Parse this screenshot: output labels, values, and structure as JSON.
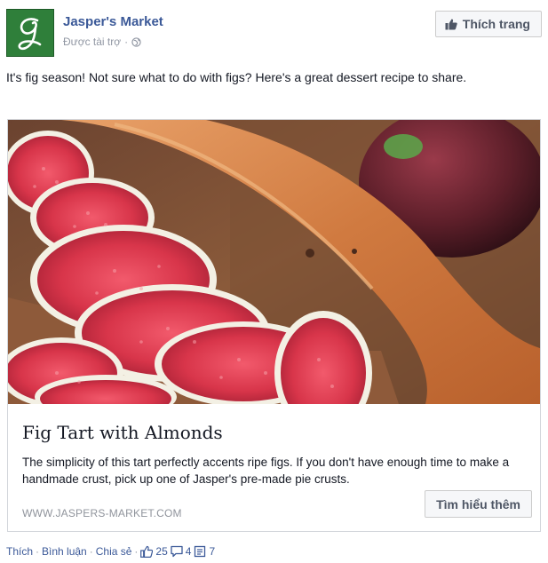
{
  "header": {
    "page_name": "Jasper's Market",
    "sponsored_label": "Được tài trợ",
    "separator": "·",
    "like_page_label": "Thích trang",
    "avatar_letter": "g"
  },
  "post": {
    "text": "It's fig season! Not sure what to do with figs? Here's a great dessert recipe to share."
  },
  "card": {
    "title": "Fig Tart with Almonds",
    "description": "The simplicity of this tart perfectly accents ripe figs. If you don't have enough time to make a handmade crust, pick up one of Jasper's pre-made pie crusts.",
    "domain": "WWW.JASPERS-MARKET.COM",
    "cta_label": "Tìm hiểu thêm"
  },
  "actions": {
    "like_label": "Thích",
    "comment_label": "Bình luận",
    "share_label": "Chia sẻ",
    "separator": "·",
    "likes_count": "25",
    "comments_count": "4",
    "shares_count": "7"
  },
  "colors": {
    "link_blue": "#3b5998",
    "avatar_green": "#2f7f3a"
  },
  "icons": {
    "globe": "globe-icon",
    "like": "thumbs-up-icon",
    "comment": "comment-icon",
    "share": "share-count-icon"
  }
}
